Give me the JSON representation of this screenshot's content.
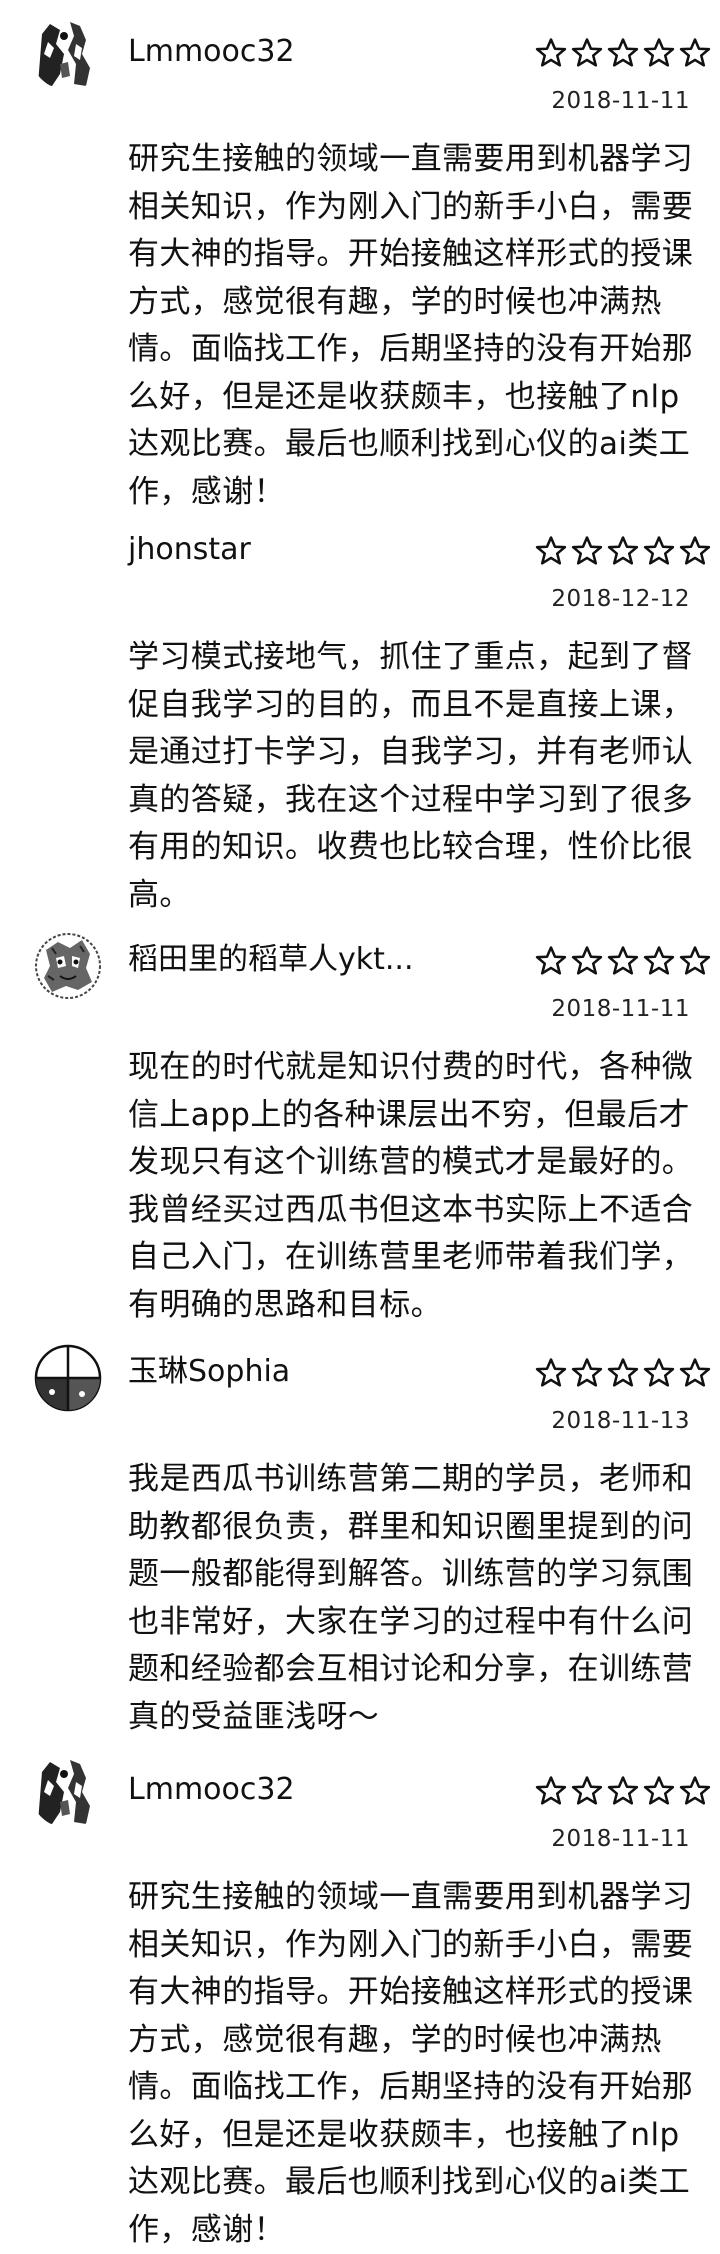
{
  "reviews": [
    {
      "username": "Lmmooc32",
      "avatar": "sketch-portrait-avatar",
      "stars_icon": "star-outline-icon",
      "date": "2018-11-11",
      "content": "研究生接触的领域一直需要用到机器学习相关知识，作为刚入门的新手小白，需要有大神的指导。开始接触这样形式的授课方式，感觉很有趣，学的时候也冲满热情。面临找工作，后期坚持的没有开始那么好，但是还是收获颇丰，也接触了nlp达观比赛。最后也顺利找到心仪的ai类工作，感谢！"
    },
    {
      "username": "jhonstar",
      "avatar": "none",
      "stars_icon": "star-outline-icon",
      "date": "2018-12-12",
      "content": "学习模式接地气，抓住了重点，起到了督促自我学习的目的，而且不是直接上课，是通过打卡学习，自我学习，并有老师认真的答疑，我在这个过程中学习到了很多有用的知识。收费也比较合理，性价比很高。"
    },
    {
      "username": "稻田里的稻草人ykt...",
      "avatar": "sketch-face-avatar",
      "stars_icon": "star-outline-icon",
      "date": "2018-11-11",
      "content": "现在的时代就是知识付费的时代，各种微信上app上的各种课层出不穷，但最后才发现只有这个训练营的模式才是最好的。我曾经买过西瓜书但这本书实际上不适合自己入门，在训练营里老师带着我们学，有明确的思路和目标。"
    },
    {
      "username": "玉琳Sophia",
      "avatar": "quartered-circle-avatar",
      "stars_icon": "star-outline-icon",
      "date": "2018-11-13",
      "content": "我是西瓜书训练营第二期的学员，老师和助教都很负责，群里和知识圈里提到的问题一般都能得到解答。训练营的学习氛围也非常好，大家在学习的过程中有什么问题和经验都会互相讨论和分享，在训练营真的受益匪浅呀～"
    },
    {
      "username": "Lmmooc32",
      "avatar": "sketch-portrait-avatar",
      "stars_icon": "star-outline-icon",
      "date": "2018-11-11",
      "content": "研究生接触的领域一直需要用到机器学习相关知识，作为刚入门的新手小白，需要有大神的指导。开始接触这样形式的授课方式，感觉很有趣，学的时候也冲满热情。面临找工作，后期坚持的没有开始那么好，但是还是收获颇丰，也接触了nlp达观比赛。最后也顺利找到心仪的ai类工作，感谢！"
    }
  ]
}
